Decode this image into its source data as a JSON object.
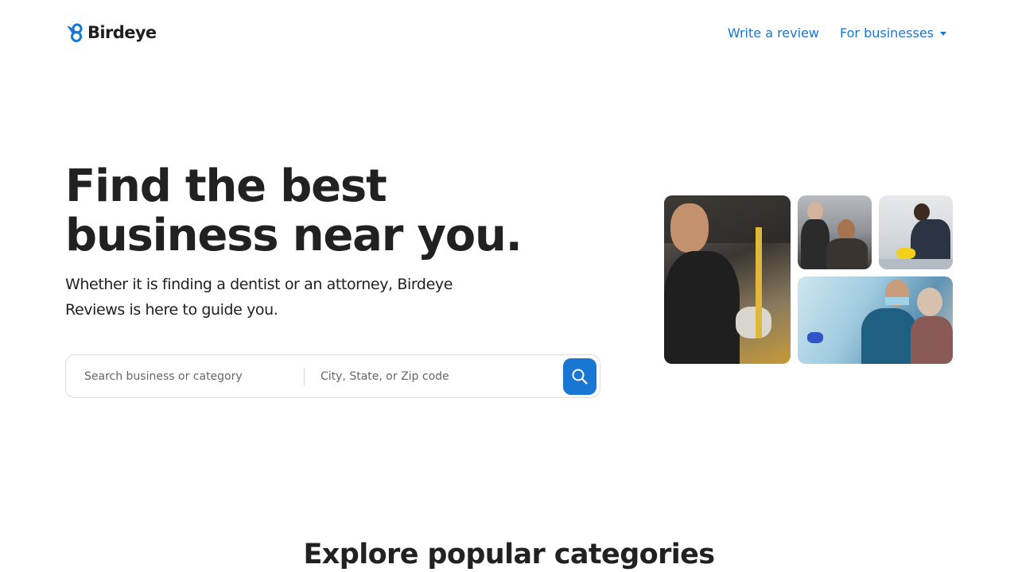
{
  "header": {
    "logo_text": "Birdeye",
    "nav": {
      "write_review": "Write a review",
      "for_businesses": "For businesses"
    }
  },
  "hero": {
    "title_line1": "Find the best",
    "title_line2": "business near you.",
    "subtitle": "Whether it is finding a dentist or an attorney, Birdeye Reviews is here to guide you."
  },
  "search": {
    "business_placeholder": "Search business or category",
    "location_placeholder": "City, State, or Zip code"
  },
  "photos": [
    "mechanic-photo",
    "business-meeting-photo",
    "cleaner-photo",
    "dental-care-photo"
  ],
  "categories": {
    "title": "Explore popular categories"
  },
  "colors": {
    "accent": "#1976d2",
    "text": "#212121"
  }
}
